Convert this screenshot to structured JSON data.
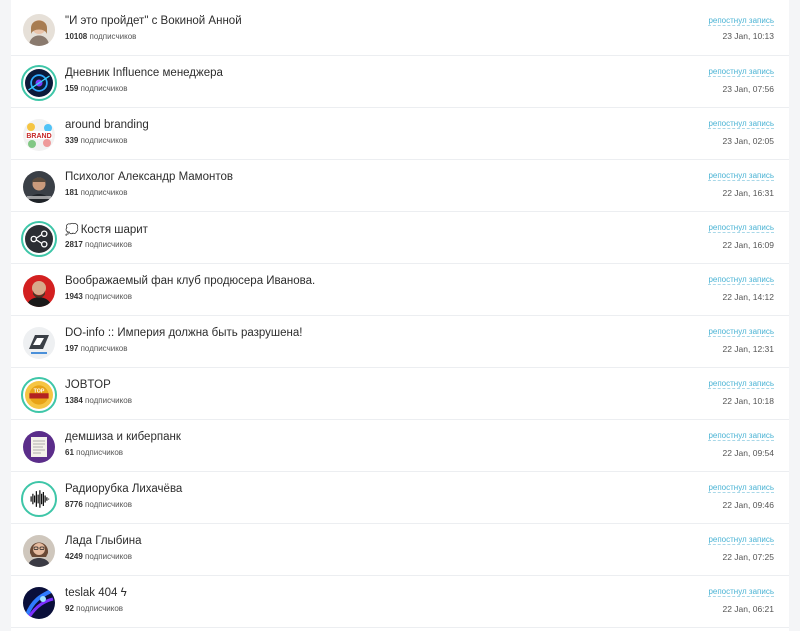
{
  "subs_suffix": "подписчиков",
  "items": [
    {
      "title": "\"И это пройдет\" с Вокиной Анной",
      "subscribers": "10108",
      "action": "репостнул запись",
      "time": "23 Jan, 10:13",
      "avatar": "person-photo"
    },
    {
      "title": "Дневник Influence менеджера",
      "subscribers": "159",
      "action": "репостнул запись",
      "time": "23 Jan, 07:56",
      "avatar": "abstract-blue-logo"
    },
    {
      "title": "around branding",
      "subscribers": "339",
      "action": "репостнул запись",
      "time": "23 Jan, 02:05",
      "avatar": "brand-logo"
    },
    {
      "title": "Психолог Александр Мамонтов",
      "subscribers": "181",
      "action": "репостнул запись",
      "time": "22 Jan, 16:31",
      "avatar": "person-photo"
    },
    {
      "title": "Костя шарит",
      "emoji": "💭",
      "subscribers": "2817",
      "action": "репостнул запись",
      "time": "22 Jan, 16:09",
      "avatar": "share-logo"
    },
    {
      "title": "Воображаемый фан клуб продюсера Иванова.",
      "subscribers": "1943",
      "action": "репостнул запись",
      "time": "22 Jan, 14:12",
      "avatar": "person-photo"
    },
    {
      "title": "DO-info :: Империя должна быть разрушена!",
      "subscribers": "197",
      "action": "репостнул запись",
      "time": "22 Jan, 12:31",
      "avatar": "emblem-logo"
    },
    {
      "title": "JOBTOP",
      "subscribers": "1384",
      "action": "репостнул запись",
      "time": "22 Jan, 10:18",
      "avatar": "top-badge"
    },
    {
      "title": "демшиза и киберпанк",
      "subscribers": "61",
      "action": "репостнул запись",
      "time": "22 Jan, 09:54",
      "avatar": "document-image"
    },
    {
      "title": "Радиорубка Лихачёва",
      "subscribers": "8776",
      "action": "репостнул запись",
      "time": "22 Jan, 09:46",
      "avatar": "soundwave-logo"
    },
    {
      "title": "Лада Глыбина",
      "subscribers": "4249",
      "action": "репостнул запись",
      "time": "22 Jan, 07:25",
      "avatar": "person-photo"
    },
    {
      "title": "teslak 404 ϟ",
      "subscribers": "92",
      "action": "репостнул запись",
      "time": "22 Jan, 06:21",
      "avatar": "neon-blue-image"
    }
  ]
}
